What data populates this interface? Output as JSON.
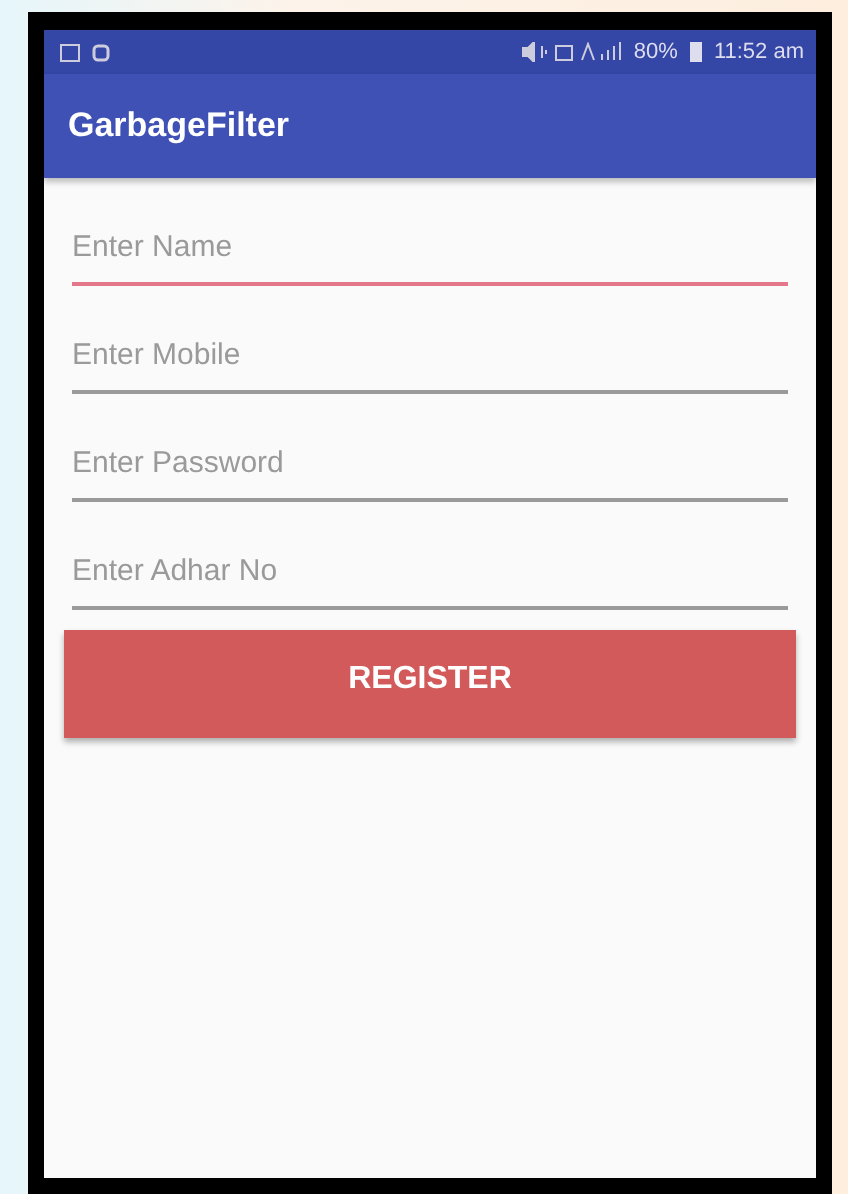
{
  "status_bar": {
    "battery": "80%",
    "time": "11:52 am"
  },
  "app_bar": {
    "title": "GarbageFilter"
  },
  "fields": [
    {
      "placeholder": "Enter Name",
      "focused": true
    },
    {
      "placeholder": "Enter Mobile",
      "focused": false
    },
    {
      "placeholder": "Enter Password",
      "focused": false
    },
    {
      "placeholder": "Enter Adhar No",
      "focused": false
    }
  ],
  "button": {
    "label": "REGISTER"
  }
}
